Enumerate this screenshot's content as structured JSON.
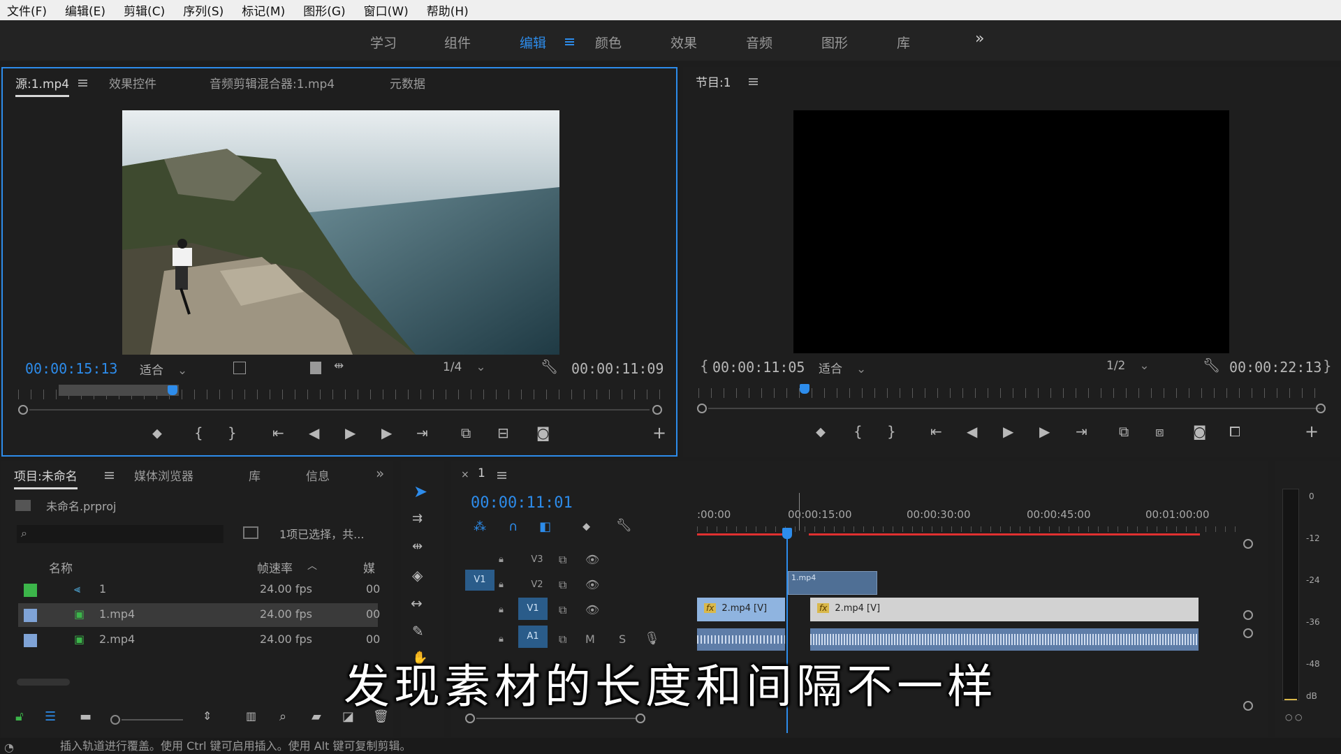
{
  "menu": [
    "文件(F)",
    "编辑(E)",
    "剪辑(C)",
    "序列(S)",
    "标记(M)",
    "图形(G)",
    "窗口(W)",
    "帮助(H)"
  ],
  "workspaces": [
    {
      "label": "学习"
    },
    {
      "label": "组件"
    },
    {
      "label": "编辑",
      "active": true
    },
    {
      "label": "颜色"
    },
    {
      "label": "效果"
    },
    {
      "label": "音频"
    },
    {
      "label": "图形"
    },
    {
      "label": "库"
    }
  ],
  "workspace_more": "»",
  "source_panel": {
    "tabs": [
      "源:1.mp4",
      "效果控件",
      "音频剪辑混合器:1.mp4",
      "元数据"
    ],
    "timecode_current": "00:00:15:13",
    "fit": "适合",
    "resolution": "1/4",
    "timecode_duration": "00:00:11:09",
    "playhead_fraction": 0.24
  },
  "program_panel": {
    "title": "节目:1",
    "timecode_current": "00:00:11:05",
    "fit": "适合",
    "resolution": "1/2",
    "timecode_duration": "00:00:22:13",
    "playhead_fraction": 0.17
  },
  "project_panel": {
    "tabs": [
      "项目:未命名",
      "媒体浏览器",
      "库",
      "信息"
    ],
    "more": "»",
    "file": "未命名.prproj",
    "selection_info": "1项已选择，共...",
    "columns": [
      "名称",
      "帧速率",
      "媒"
    ],
    "items": [
      {
        "name": "1",
        "fps": "24.00 fps",
        "media": "00",
        "color": "#3cb54a",
        "selected": false
      },
      {
        "name": "1.mp4",
        "fps": "24.00 fps",
        "media": "00",
        "color": "#7fa3d6",
        "selected": true
      },
      {
        "name": "2.mp4",
        "fps": "24.00 fps",
        "media": "00",
        "color": "#7fa3d6",
        "selected": false
      }
    ]
  },
  "timeline": {
    "sequence": "1",
    "timecode": "00:00:11:01",
    "ruler_labels": [
      ":00:00",
      "00:00:15:00",
      "00:00:30:00",
      "00:00:45:00",
      "00:01:00:00"
    ],
    "tracks": [
      "V3",
      "V2",
      "V1",
      "A1"
    ],
    "source_patch": "V1",
    "source_patch_audio": "A1",
    "mute": "M",
    "solo": "S",
    "clips": {
      "v1_clip_a": "2.mp4 [V]",
      "v1_clip_b": "2.mp4 [V]",
      "v2_clip": "1.mp4",
      "fx": "fx"
    }
  },
  "audio_meter_labels": [
    "0",
    "-12",
    "-24",
    "-36",
    "-48",
    "dB"
  ],
  "subtitle": "发现素材的长度和间隔不一样",
  "status": "插入轨道进行覆盖。使用 Ctrl 键可启用插入。使用 Alt 键可复制剪辑。"
}
